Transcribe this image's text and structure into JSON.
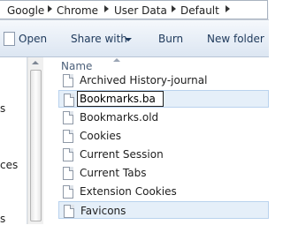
{
  "address": {
    "crumbs": [
      "Google",
      "Chrome",
      "User Data",
      "Default"
    ]
  },
  "toolbar": {
    "open_label": "Open",
    "share_label": "Share with",
    "burn_label": "Burn",
    "new_folder_label": "New folder"
  },
  "nav_fragments": [
    "s",
    "ces",
    "s"
  ],
  "filelist": {
    "header": "Name",
    "rename_value": "Bookmarks.ba",
    "items": [
      "Archived History-journal",
      "Bookmarks.ba",
      "Bookmarks.old",
      "Cookies",
      "Current Session",
      "Current Tabs",
      "Extension Cookies",
      "Favicons"
    ]
  },
  "icons": {
    "open": "document-icon",
    "file": "file-icon",
    "breadcrumb_separator": "chevron-right-icon",
    "dropdown": "chevron-down-icon"
  }
}
